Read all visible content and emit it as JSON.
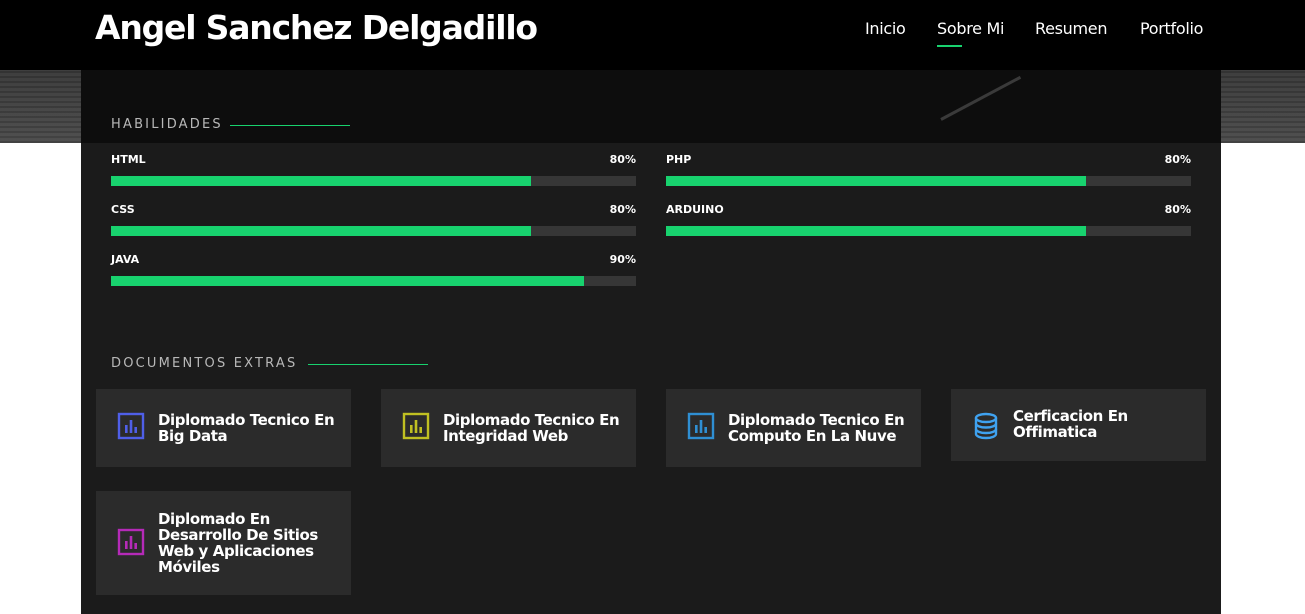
{
  "header": {
    "brand": "Angel Sanchez Delgadillo",
    "nav": [
      {
        "label": "Inicio"
      },
      {
        "label": "Sobre Mi"
      },
      {
        "label": "Resumen"
      },
      {
        "label": "Portfolio"
      }
    ],
    "active_nav": "Sobre Mi"
  },
  "colors": {
    "accent": "#18d26e",
    "panel": "#1b1b1b",
    "card": "#2b2b2b"
  },
  "skills": {
    "title": "HABILIDADES",
    "items": [
      {
        "name": "HTML",
        "percent_label": "80%",
        "value": 80
      },
      {
        "name": "PHP",
        "percent_label": "80%",
        "value": 80
      },
      {
        "name": "CSS",
        "percent_label": "80%",
        "value": 80
      },
      {
        "name": "ARDUINO",
        "percent_label": "80%",
        "value": 80
      },
      {
        "name": "JAVA",
        "percent_label": "90%",
        "value": 90
      }
    ]
  },
  "documents": {
    "title": "DOCUMENTOS EXTRAS",
    "items": [
      {
        "label": "Diplomado Tecnico En Big Data",
        "icon": "bar-chart-icon",
        "icon_color": "#4f5fe8"
      },
      {
        "label": "Diplomado Tecnico En Integridad Web",
        "icon": "bar-chart-icon",
        "icon_color": "#c0c022"
      },
      {
        "label": "Diplomado Tecnico En Computo En La Nuve",
        "icon": "bar-chart-icon",
        "icon_color": "#2f8fd3"
      },
      {
        "label": "Cerficacion En Offimatica",
        "icon": "database-icon",
        "icon_color": "#3fa2f0"
      },
      {
        "label": "Diplomado En Desarrollo De Sitios Web y Aplicaciones Móviles",
        "icon": "bar-chart-icon",
        "icon_color": "#b52ab8"
      }
    ]
  }
}
